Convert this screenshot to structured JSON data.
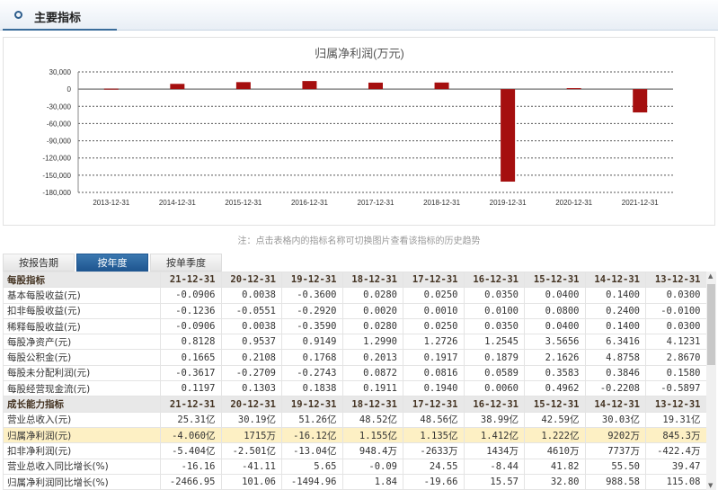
{
  "header": {
    "title": "主要指标"
  },
  "chart_data": {
    "type": "bar",
    "title": "归属净利润(万元)",
    "categories": [
      "2013-12-31",
      "2014-12-31",
      "2015-12-31",
      "2016-12-31",
      "2017-12-31",
      "2018-12-31",
      "2019-12-31",
      "2020-12-31",
      "2021-12-31"
    ],
    "values": [
      845.3,
      9202,
      12220,
      14120,
      11350,
      11550,
      -161200,
      1715,
      -40600
    ],
    "ylim": [
      -180000,
      30000
    ],
    "yticks": [
      30000,
      0,
      -30000,
      -60000,
      -90000,
      -120000,
      -150000,
      -180000
    ],
    "ytick_labels": [
      "30,000",
      "0",
      "-30,000",
      "-60,000",
      "-90,000",
      "-120,000",
      "-150,000",
      "-180,000"
    ],
    "grid": true,
    "color": "#a50f0f"
  },
  "note": "注：点击表格内的指标名称可切换图片查看该指标的历史趋势",
  "tabs": [
    "按报告期",
    "按年度",
    "按单季度"
  ],
  "active_tab": 1,
  "table": {
    "dates": [
      "21-12-31",
      "20-12-31",
      "19-12-31",
      "18-12-31",
      "17-12-31",
      "16-12-31",
      "15-12-31",
      "14-12-31",
      "13-12-31"
    ],
    "sections": [
      {
        "title": "每股指标",
        "rows": [
          {
            "label": "基本每股收益(元)",
            "values": [
              "-0.0906",
              "0.0038",
              "-0.3600",
              "0.0280",
              "0.0250",
              "0.0350",
              "0.0400",
              "0.1400",
              "0.0300"
            ]
          },
          {
            "label": "扣非每股收益(元)",
            "values": [
              "-0.1236",
              "-0.0551",
              "-0.2920",
              "0.0020",
              "0.0010",
              "0.0100",
              "0.0800",
              "0.2400",
              "-0.0100"
            ]
          },
          {
            "label": "稀释每股收益(元)",
            "values": [
              "-0.0906",
              "0.0038",
              "-0.3590",
              "0.0280",
              "0.0250",
              "0.0350",
              "0.0400",
              "0.1400",
              "0.0300"
            ]
          },
          {
            "label": "每股净资产(元)",
            "values": [
              "0.8128",
              "0.9537",
              "0.9149",
              "1.2990",
              "1.2726",
              "1.2545",
              "3.5656",
              "6.3416",
              "4.1231"
            ]
          },
          {
            "label": "每股公积金(元)",
            "values": [
              "0.1665",
              "0.2108",
              "0.1768",
              "0.2013",
              "0.1917",
              "0.1879",
              "2.1626",
              "4.8758",
              "2.8670"
            ]
          },
          {
            "label": "每股未分配利润(元)",
            "values": [
              "-0.3617",
              "-0.2709",
              "-0.2743",
              "0.0872",
              "0.0816",
              "0.0589",
              "0.3583",
              "0.3846",
              "0.1580"
            ]
          },
          {
            "label": "每股经营现金流(元)",
            "values": [
              "0.1197",
              "0.1303",
              "0.1838",
              "0.1911",
              "0.1940",
              "0.0060",
              "0.4962",
              "-0.2208",
              "-0.5897"
            ]
          }
        ]
      },
      {
        "title": "成长能力指标",
        "rows": [
          {
            "label": "营业总收入(元)",
            "values": [
              "25.31亿",
              "30.19亿",
              "51.26亿",
              "48.52亿",
              "48.56亿",
              "38.99亿",
              "42.59亿",
              "30.03亿",
              "19.31亿"
            ]
          },
          {
            "label": "归属净利润(元)",
            "highlight": true,
            "values": [
              "-4.060亿",
              "1715万",
              "-16.12亿",
              "1.155亿",
              "1.135亿",
              "1.412亿",
              "1.222亿",
              "9202万",
              "845.3万"
            ]
          },
          {
            "label": "扣非净利润(元)",
            "values": [
              "-5.404亿",
              "-2.501亿",
              "-13.04亿",
              "948.4万",
              "-2633万",
              "1434万",
              "4610万",
              "7737万",
              "-422.4万"
            ]
          },
          {
            "label": "营业总收入同比增长(%)",
            "values": [
              "-16.16",
              "-41.11",
              "5.65",
              "-0.09",
              "24.55",
              "-8.44",
              "41.82",
              "55.50",
              "39.47"
            ]
          },
          {
            "label": "归属净利润同比增长(%)",
            "values": [
              "-2466.95",
              "101.06",
              "-1494.96",
              "1.84",
              "-19.66",
              "15.57",
              "32.80",
              "988.58",
              "115.08"
            ]
          }
        ]
      }
    ]
  }
}
